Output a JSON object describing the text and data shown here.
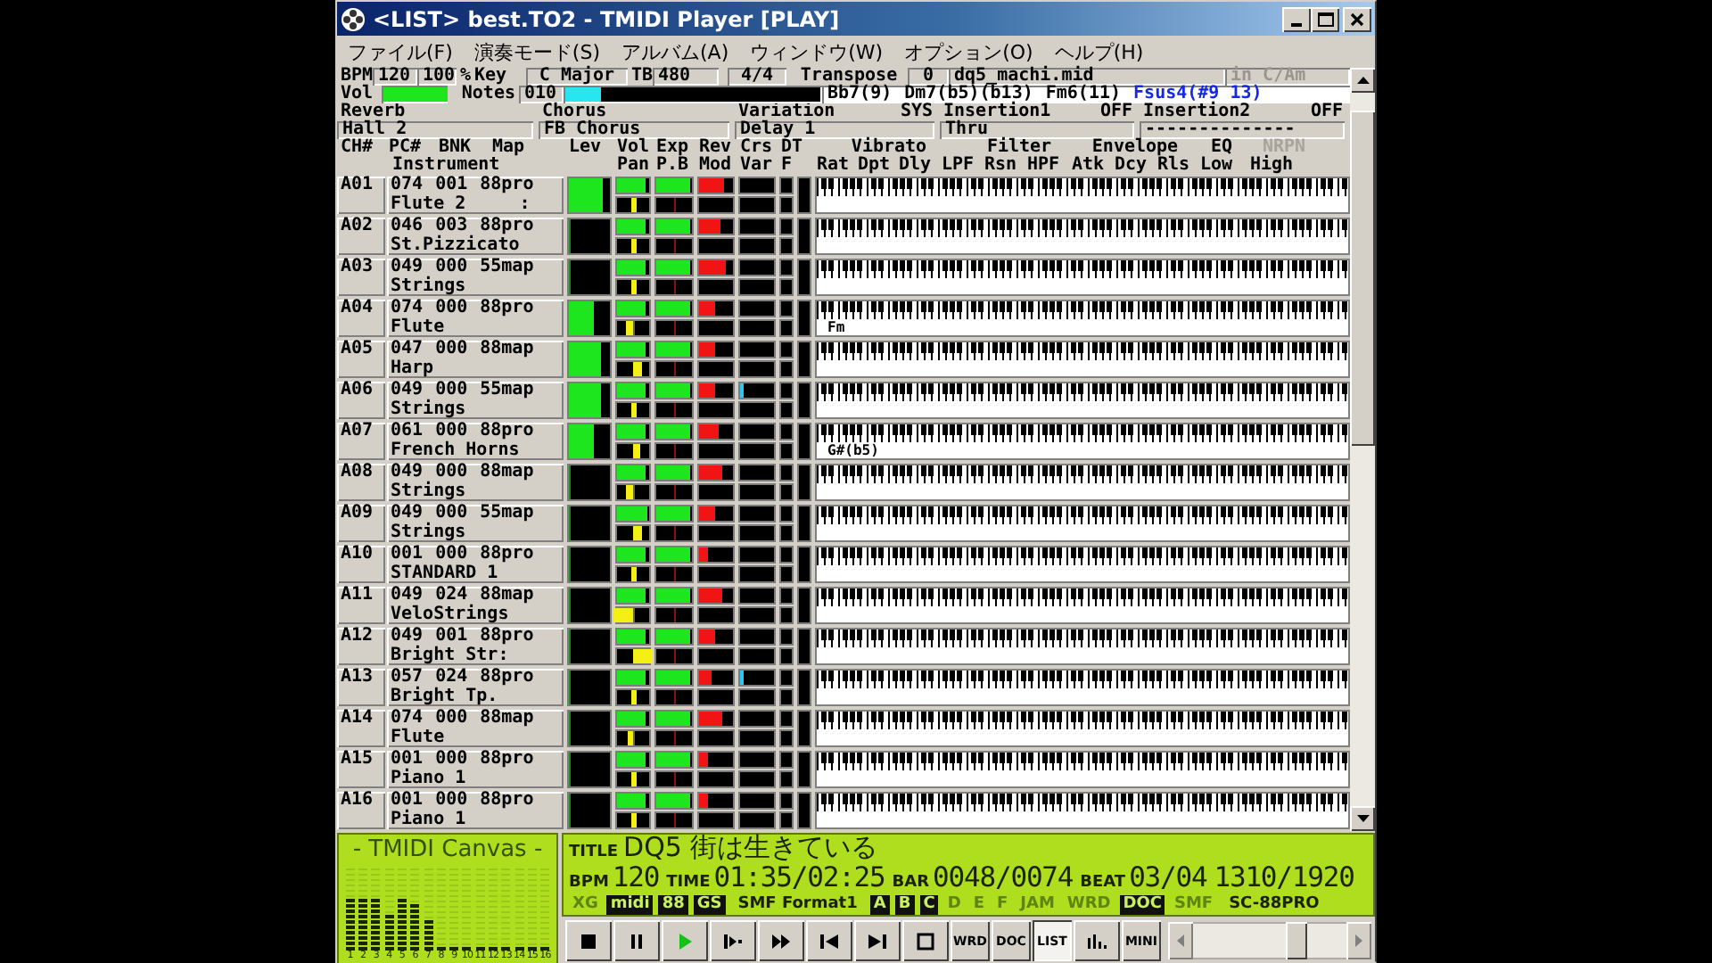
{
  "window": {
    "title": "<LIST> best.TO2 - TMIDI Player [PLAY]"
  },
  "menu": [
    "ファイル(F)",
    "演奏モード(S)",
    "アルバム(A)",
    "ウィンドウ(W)",
    "オプション(O)",
    "ヘルプ(H)"
  ],
  "status": {
    "bpm_label": "BPM",
    "bpm": "120",
    "tempo_percent": "100",
    "percent_sign": "%",
    "key_label": "Key",
    "key": "C Major",
    "tb_label": "TB",
    "tb": "480",
    "time_signature": "4/4",
    "transpose_label": "Transpose",
    "transpose": "0",
    "file": "dq5_machi.mid",
    "key_hint": "in C/Am"
  },
  "volume": {
    "label": "Vol",
    "level": 0.97
  },
  "notes": {
    "label": "Notes",
    "value": "010",
    "level": 0.14
  },
  "chords": [
    {
      "text": "Bb7(9)",
      "current": false
    },
    {
      "text": "Dm7(b5)(b13)",
      "current": false
    },
    {
      "text": "Fm6(11)",
      "current": false
    },
    {
      "text": "Fsus4(#9 13)",
      "current": true
    }
  ],
  "effects": [
    {
      "label": "Reverb",
      "value": "Hall 2"
    },
    {
      "label": "Chorus",
      "value": "FB Chorus"
    },
    {
      "label": "Variation",
      "tag": "SYS",
      "value": "Delay 1"
    },
    {
      "label": "Insertion1",
      "tag": "OFF",
      "value": "Thru"
    },
    {
      "label": "Insertion2",
      "tag": "OFF",
      "value": "--------------"
    }
  ],
  "headers_top": [
    {
      "text": "CH#",
      "disabled": false
    },
    {
      "text": "PC#",
      "disabled": false
    },
    {
      "text": "BNK",
      "disabled": false
    },
    {
      "text": "Map",
      "disabled": false
    },
    {
      "text": "Lev",
      "disabled": false
    },
    {
      "text": "Vol",
      "disabled": false
    },
    {
      "text": "Exp",
      "disabled": false
    },
    {
      "text": "Rev",
      "disabled": false
    },
    {
      "text": "Crs",
      "disabled": false
    },
    {
      "text": "DT",
      "disabled": false
    },
    {
      "text": "Vibrato",
      "disabled": false
    },
    {
      "text": "Filter",
      "disabled": false
    },
    {
      "text": "Envelope",
      "disabled": false
    },
    {
      "text": "EQ",
      "disabled": false
    },
    {
      "text": "NRPN",
      "disabled": true
    }
  ],
  "headers_bottom": [
    "Instrument",
    "Pan",
    "P.B",
    "Mod",
    "Var",
    "F",
    "Rat",
    "Dpt",
    "Dly",
    "LPF",
    "Rsn",
    "HPF",
    "Atk",
    "Dcy",
    "Rls",
    "Low",
    "High"
  ],
  "channels": [
    {
      "ch": "A01",
      "pc": "074",
      "bank": "001",
      "map": "88pro",
      "instrument": "Flute 2     :",
      "lev": {
        "level": 0.75
      },
      "vol": {
        "level": 0.8
      },
      "pan": {
        "level": 0.5
      },
      "exp": {
        "level": 0.88
      },
      "rev": {
        "level": 0.65
      }
    },
    {
      "ch": "A02",
      "pc": "046",
      "bank": "003",
      "map": "88pro",
      "instrument": "St.Pizzicato",
      "lev": {
        "level": 0
      },
      "vol": {
        "level": 0.78
      },
      "pan": {
        "level": 0.5
      },
      "exp": {
        "level": 0.88
      },
      "rev": {
        "level": 0.55
      }
    },
    {
      "ch": "A03",
      "pc": "049",
      "bank": "000",
      "map": "55map",
      "instrument": "Strings",
      "lev": {
        "level": 0
      },
      "vol": {
        "level": 0.78
      },
      "pan": {
        "level": 0.5
      },
      "exp": {
        "level": 0.88
      },
      "rev": {
        "level": 0.7
      }
    },
    {
      "ch": "A04",
      "pc": "074",
      "bank": "000",
      "map": "88pro",
      "instrument": "Flute",
      "lev": {
        "level": 0.55
      },
      "vol": {
        "level": 0.78
      },
      "pan": {
        "level": 0.35
      },
      "exp": {
        "level": 0.88
      },
      "rev": {
        "level": 0.45
      },
      "chord": "Fm"
    },
    {
      "ch": "A05",
      "pc": "047",
      "bank": "000",
      "map": "88map",
      "instrument": "Harp",
      "lev": {
        "level": 0.7
      },
      "vol": {
        "level": 0.78
      },
      "pan": {
        "level": 0.68
      },
      "exp": {
        "level": 0.88
      },
      "rev": {
        "level": 0.45
      }
    },
    {
      "ch": "A06",
      "pc": "049",
      "bank": "000",
      "map": "55map",
      "instrument": "Strings",
      "lev": {
        "level": 0.7
      },
      "vol": {
        "level": 0.78
      },
      "pan": {
        "level": 0.5
      },
      "exp": {
        "level": 0.88
      },
      "rev": {
        "level": 0.45
      },
      "chorus": {
        "level": 0.06
      }
    },
    {
      "ch": "A07",
      "pc": "061",
      "bank": "000",
      "map": "88pro",
      "instrument": "French Horns",
      "lev": {
        "level": 0.55
      },
      "vol": {
        "level": 0.78
      },
      "pan": {
        "level": 0.65
      },
      "exp": {
        "level": 0.88
      },
      "rev": {
        "level": 0.5
      },
      "chord": "G#(b5)"
    },
    {
      "ch": "A08",
      "pc": "049",
      "bank": "000",
      "map": "88map",
      "instrument": "Strings",
      "lev": {
        "level": 0
      },
      "vol": {
        "level": 0.78
      },
      "pan": {
        "level": 0.35
      },
      "exp": {
        "level": 0.88
      },
      "rev": {
        "level": 0.6
      }
    },
    {
      "ch": "A09",
      "pc": "049",
      "bank": "000",
      "map": "55map",
      "instrument": "Strings",
      "lev": {
        "level": 0
      },
      "vol": {
        "level": 0.85
      },
      "pan": {
        "level": 0.72
      },
      "exp": {
        "level": 0.88
      },
      "rev": {
        "level": 0.45
      }
    },
    {
      "ch": "A10",
      "pc": "001",
      "bank": "000",
      "map": "88pro",
      "instrument": "STANDARD 1",
      "lev": {
        "level": 0
      },
      "vol": {
        "level": 0.78
      },
      "pan": {
        "level": 0.5
      },
      "exp": {
        "level": 0.88
      },
      "rev": {
        "level": 0.25
      }
    },
    {
      "ch": "A11",
      "pc": "049",
      "bank": "024",
      "map": "88map",
      "instrument": "VeloStrings",
      "lev": {
        "level": 0
      },
      "vol": {
        "level": 0.78
      },
      "pan": {
        "level": 0
      },
      "exp": {
        "level": 0.88
      },
      "rev": {
        "level": 0.6
      }
    },
    {
      "ch": "A12",
      "pc": "049",
      "bank": "001",
      "map": "88pro",
      "instrument": "Bright Str:",
      "lev": {
        "level": 0
      },
      "vol": {
        "level": 0.78
      },
      "pan": {
        "level": 1
      },
      "exp": {
        "level": 0.88
      },
      "rev": {
        "level": 0.45
      }
    },
    {
      "ch": "A13",
      "pc": "057",
      "bank": "024",
      "map": "88pro",
      "instrument": "Bright Tp.",
      "lev": {
        "level": 0
      },
      "vol": {
        "level": 0.78
      },
      "pan": {
        "level": 0.5
      },
      "exp": {
        "level": 0.88
      },
      "rev": {
        "level": 0.35
      },
      "chorus": {
        "level": 0.06
      }
    },
    {
      "ch": "A14",
      "pc": "074",
      "bank": "000",
      "map": "88map",
      "instrument": "Flute",
      "lev": {
        "level": 0
      },
      "vol": {
        "level": 0.78
      },
      "pan": {
        "level": 0.4
      },
      "exp": {
        "level": 0.88
      },
      "rev": {
        "level": 0.6
      }
    },
    {
      "ch": "A15",
      "pc": "001",
      "bank": "000",
      "map": "88pro",
      "instrument": "Piano 1",
      "lev": {
        "level": 0
      },
      "vol": {
        "level": 0.78
      },
      "pan": {
        "level": 0.5
      },
      "exp": {
        "level": 0.88
      },
      "rev": {
        "level": 0.25
      }
    },
    {
      "ch": "A16",
      "pc": "001",
      "bank": "000",
      "map": "88pro",
      "instrument": "Piano 1",
      "lev": {
        "level": 0
      },
      "vol": {
        "level": 0.78
      },
      "pan": {
        "level": 0.5
      },
      "exp": {
        "level": 0.88
      },
      "rev": {
        "level": 0.25
      }
    }
  ],
  "canvas": {
    "title": "- TMIDI Canvas -",
    "bars": [
      {
        "label": "1",
        "level": 0.62
      },
      {
        "label": "2",
        "level": 0.62
      },
      {
        "label": "3",
        "level": 0.62
      },
      {
        "label": "4",
        "level": 0.44
      },
      {
        "label": "5",
        "level": 0.62
      },
      {
        "label": "6",
        "level": 0.56
      },
      {
        "label": "7",
        "level": 0.36
      },
      {
        "label": "8",
        "level": 0.04
      },
      {
        "label": "9",
        "level": 0.04
      },
      {
        "label": "10",
        "level": 0.04
      },
      {
        "label": "11",
        "level": 0.04
      },
      {
        "label": "12",
        "level": 0.04
      },
      {
        "label": "13",
        "level": 0.04
      },
      {
        "label": "14",
        "level": 0.04
      },
      {
        "label": "15",
        "level": 0.04
      },
      {
        "label": "16",
        "level": 0.04
      }
    ]
  },
  "song": {
    "title_label": "TITLE",
    "title": "DQ5 街は生きている",
    "bpm_label": "BPM",
    "bpm": "120",
    "time_label": "TIME",
    "time": "01:35/02:25",
    "bar_label": "BAR",
    "bar": "0048/0074",
    "beat_label": "BEAT",
    "beat": "03/04",
    "tick": "1310/1920"
  },
  "indicators": [
    {
      "kind": "flag",
      "text": "XG",
      "on": false
    },
    {
      "kind": "flag",
      "text": "midi",
      "on": true
    },
    {
      "kind": "flag",
      "text": "88",
      "on": true
    },
    {
      "kind": "flag",
      "text": "GS",
      "on": true
    },
    {
      "kind": "text",
      "text": "SMF Format1"
    },
    {
      "kind": "flag",
      "text": "A",
      "on": true
    },
    {
      "kind": "flag",
      "text": "B",
      "on": true
    },
    {
      "kind": "flag",
      "text": "C",
      "on": true
    },
    {
      "kind": "flag",
      "text": "D",
      "on": false
    },
    {
      "kind": "flag",
      "text": "E",
      "on": false
    },
    {
      "kind": "flag",
      "text": "F",
      "on": false
    },
    {
      "kind": "flag",
      "text": "JAM",
      "on": false
    },
    {
      "kind": "flag",
      "text": "WRD",
      "on": false
    },
    {
      "kind": "flag",
      "text": "DOC",
      "on": true
    },
    {
      "kind": "flag",
      "text": "SMF",
      "on": false
    },
    {
      "kind": "text",
      "text": "SC-88PRO"
    }
  ],
  "transport": [
    {
      "kind": "stop",
      "selected": false
    },
    {
      "kind": "pause",
      "selected": false
    },
    {
      "kind": "play",
      "selected": false
    },
    {
      "kind": "step",
      "selected": false
    },
    {
      "kind": "fast_forward",
      "selected": false
    },
    {
      "kind": "previous",
      "selected": false
    },
    {
      "kind": "next",
      "selected": false
    },
    {
      "kind": "window",
      "selected": false
    },
    {
      "kind": "text",
      "label": "WRD",
      "selected": false
    },
    {
      "kind": "text",
      "label": "DOC",
      "selected": false
    },
    {
      "kind": "text",
      "label": "LIST",
      "selected": true
    },
    {
      "kind": "visualizer",
      "selected": false
    },
    {
      "kind": "text",
      "label": "MINI",
      "selected": false
    }
  ],
  "position_slider": {
    "level": 0.7
  }
}
